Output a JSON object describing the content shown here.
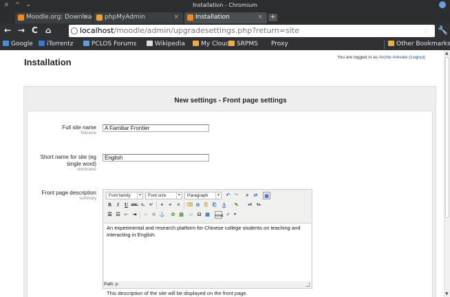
{
  "window": {
    "title": "Installation - Chromium",
    "controls": [
      "×",
      "^",
      "⌄"
    ]
  },
  "tabs": [
    {
      "label": "Moodle.org: Download",
      "icon": "moodle-icon",
      "color": "#f08a24",
      "active": false
    },
    {
      "label": "phpMyAdmin",
      "icon": "phpmyadmin-icon",
      "color": "#e8a040",
      "active": false
    },
    {
      "label": "Installation",
      "icon": "moodle-icon",
      "color": "#f08a24",
      "active": true
    }
  ],
  "newtab_label": "+",
  "nav": {
    "back": "←",
    "forward": "→",
    "reload": "C",
    "home": "⌂"
  },
  "url": {
    "host": "localhost",
    "path": "/moodle/admin/upgradesettings.php?return=site"
  },
  "bookmarks": [
    {
      "label": "Google",
      "icon": "google-icon"
    },
    {
      "label": "iTorrentz",
      "icon": "torrentz-icon"
    },
    {
      "label": "PCLOS Forums",
      "icon": "pclos-icon"
    },
    {
      "label": "Wikipedia",
      "icon": "wikipedia-icon"
    },
    {
      "label": "My Cloud",
      "icon": "folder-icon"
    },
    {
      "label": "SRPMS",
      "icon": "folder-icon"
    },
    {
      "label": "Proxy",
      "icon": ""
    },
    {
      "label": "Other Bookmarks",
      "icon": "folder-icon"
    }
  ],
  "page": {
    "heading": "Installation",
    "login_prefix": "You are logged in as ",
    "login_user": "Archie Arevalo",
    "logout": "(Logout)",
    "section_title": "New settings - Front page settings"
  },
  "fields": {
    "fullname": {
      "label": "Full site name",
      "sub": "fullname",
      "value": "A Familiar Frontier"
    },
    "shortname": {
      "label": "Short name for site (eg single word)",
      "sub": "shortname",
      "value": "English"
    },
    "summary": {
      "label": "Front page description",
      "sub": "summary",
      "font_family": "Font family",
      "font_size": "Font size",
      "paragraph": "Paragraph",
      "body": "An experimental and research platform for Chinese college students on teaching and interacting in English.",
      "path": "Path: p",
      "description": "This description of the site will be displayed on the front page."
    }
  },
  "colors": {
    "chrome_dark": "#2b2d2f",
    "link": "#1a55b0",
    "moodle_orange": "#f08a24"
  }
}
